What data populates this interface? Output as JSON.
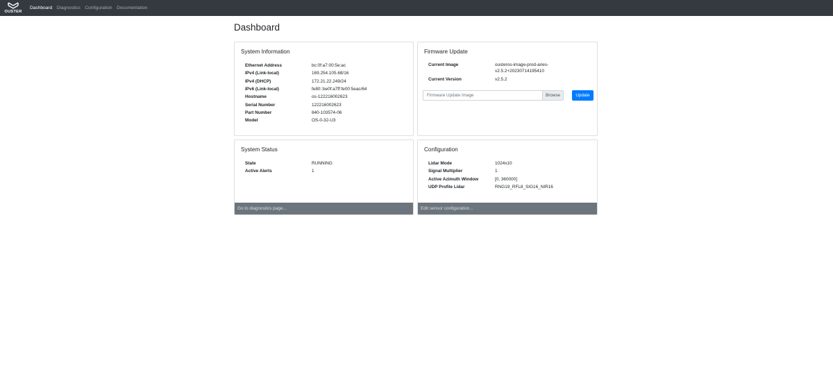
{
  "nav": {
    "brand": "OUSTER",
    "links": [
      {
        "label": "Dashboard",
        "active": true
      },
      {
        "label": "Diagnostics",
        "active": false
      },
      {
        "label": "Configuration",
        "active": false
      },
      {
        "label": "Documentation",
        "active": false
      }
    ]
  },
  "page": {
    "title": "Dashboard"
  },
  "system_information": {
    "title": "System Information",
    "rows": [
      {
        "key": "Ethernet Address",
        "value": "bc:0f:a7:00:5e:ac"
      },
      {
        "key": "IPv4 (Link-local)",
        "value": "169.254.105.68/16"
      },
      {
        "key": "IPv4 (DHCP)",
        "value": "172.21.22.249/24"
      },
      {
        "key": "IPv6 (Link-local)",
        "value": "fe80::be0f:a7ff:fe00:5eac/64"
      },
      {
        "key": "Hostname",
        "value": "os-122216002623"
      },
      {
        "key": "Serial Number",
        "value": "122216002623"
      },
      {
        "key": "Part Number",
        "value": "840-103574-06"
      },
      {
        "key": "Model",
        "value": "OS-0-32-U3"
      }
    ]
  },
  "firmware_update": {
    "title": "Firmware Update",
    "current_image_label": "Current Image",
    "current_image_value": "ousteros-image-prod-aries-v2.5.2+20230714195410",
    "current_version_label": "Current Version",
    "current_version_value": "v2.5.2",
    "file_placeholder": "Firmware Update Image",
    "browse_label": "Browse",
    "update_label": "Update"
  },
  "system_status": {
    "title": "System Status",
    "rows": [
      {
        "key": "State",
        "value": "RUNNING"
      },
      {
        "key": "Active Alerts",
        "value": "1"
      }
    ],
    "footer": "Go to diagnostics page..."
  },
  "configuration": {
    "title": "Configuration",
    "rows": [
      {
        "key": "Lidar Mode",
        "value": "1024x10"
      },
      {
        "key": "Signal Multiplier",
        "value": "1"
      },
      {
        "key": "Active Azimuth Window",
        "value": "[0, 360000]"
      },
      {
        "key": "UDP Profile Lidar",
        "value": "RNG19_RFL8_SIG16_NIR16"
      }
    ],
    "footer": "Edit sensor configuration..."
  }
}
